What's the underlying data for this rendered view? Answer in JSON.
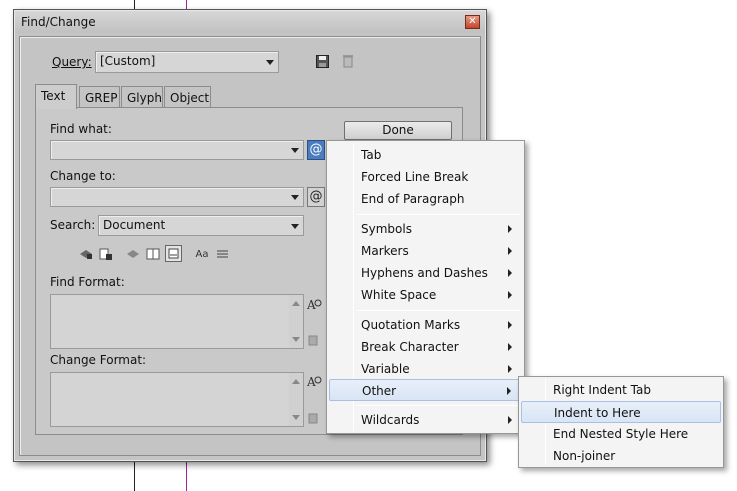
{
  "dialog": {
    "title": "Find/Change",
    "query_label": "Query:",
    "query_value": "[Custom]",
    "tabs": [
      {
        "label": "Text"
      },
      {
        "label": "GREP"
      },
      {
        "label": "Glyph"
      },
      {
        "label": "Object"
      }
    ],
    "find_what_label": "Find what:",
    "find_what_value": "",
    "change_to_label": "Change to:",
    "change_to_value": "",
    "search_label": "Search:",
    "search_value": "Document",
    "find_format_label": "Find Format:",
    "change_format_label": "Change Format:",
    "done_label": "Done",
    "case_toggle_label": "Aa",
    "special_char_icon": "@"
  },
  "menu": {
    "items": [
      {
        "label": "Tab"
      },
      {
        "label": "Forced Line Break"
      },
      {
        "label": "End of Paragraph"
      },
      {
        "label": "Symbols"
      },
      {
        "label": "Markers"
      },
      {
        "label": "Hyphens and Dashes"
      },
      {
        "label": "White Space"
      },
      {
        "label": "Quotation Marks"
      },
      {
        "label": "Break Character"
      },
      {
        "label": "Variable"
      },
      {
        "label": "Other"
      },
      {
        "label": "Wildcards"
      }
    ]
  },
  "submenu": {
    "items": [
      {
        "label": "Right Indent Tab"
      },
      {
        "label": "Indent to Here"
      },
      {
        "label": "End Nested Style Here"
      },
      {
        "label": "Non-joiner"
      }
    ]
  },
  "colors": {
    "dialog_bg": "#c4c4c4",
    "menu_bg": "#f4f4f4",
    "highlight": "#d8e5f5",
    "guide_magenta": "#a020a0"
  }
}
